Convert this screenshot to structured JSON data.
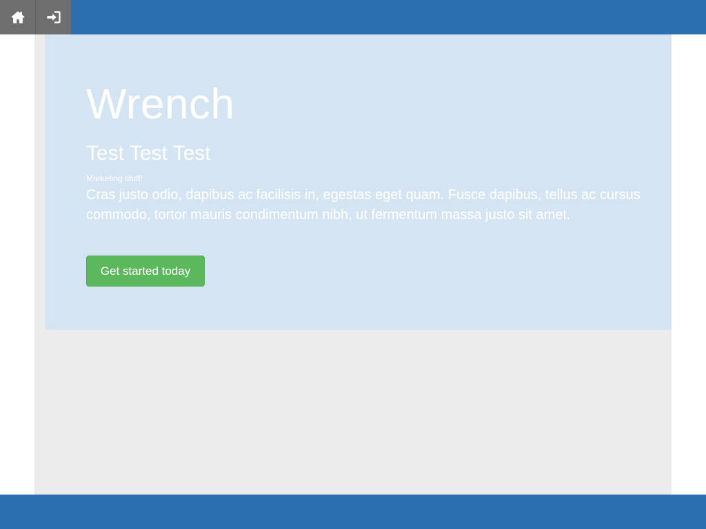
{
  "nav": {
    "items": [
      {
        "icon": "home-icon"
      },
      {
        "icon": "sign-in-icon"
      }
    ]
  },
  "hero": {
    "title": "Wrench",
    "subtitle": "Test Test Test",
    "note": "Marketing stuff!",
    "lead": "Cras justo odio, dapibus ac facilisis in, egestas eget quam. Fusce dapibus, tellus ac cursus commodo, tortor mauris condimentum nibh, ut fermentum massa justo sit amet.",
    "cta_label": "Get started today"
  },
  "colors": {
    "topbar": "#2b6fb0",
    "nav_button": "#6e6e6e",
    "jumbotron": "#d4e4f3",
    "content_bg": "#ececec",
    "cta": "#5cb85c"
  }
}
